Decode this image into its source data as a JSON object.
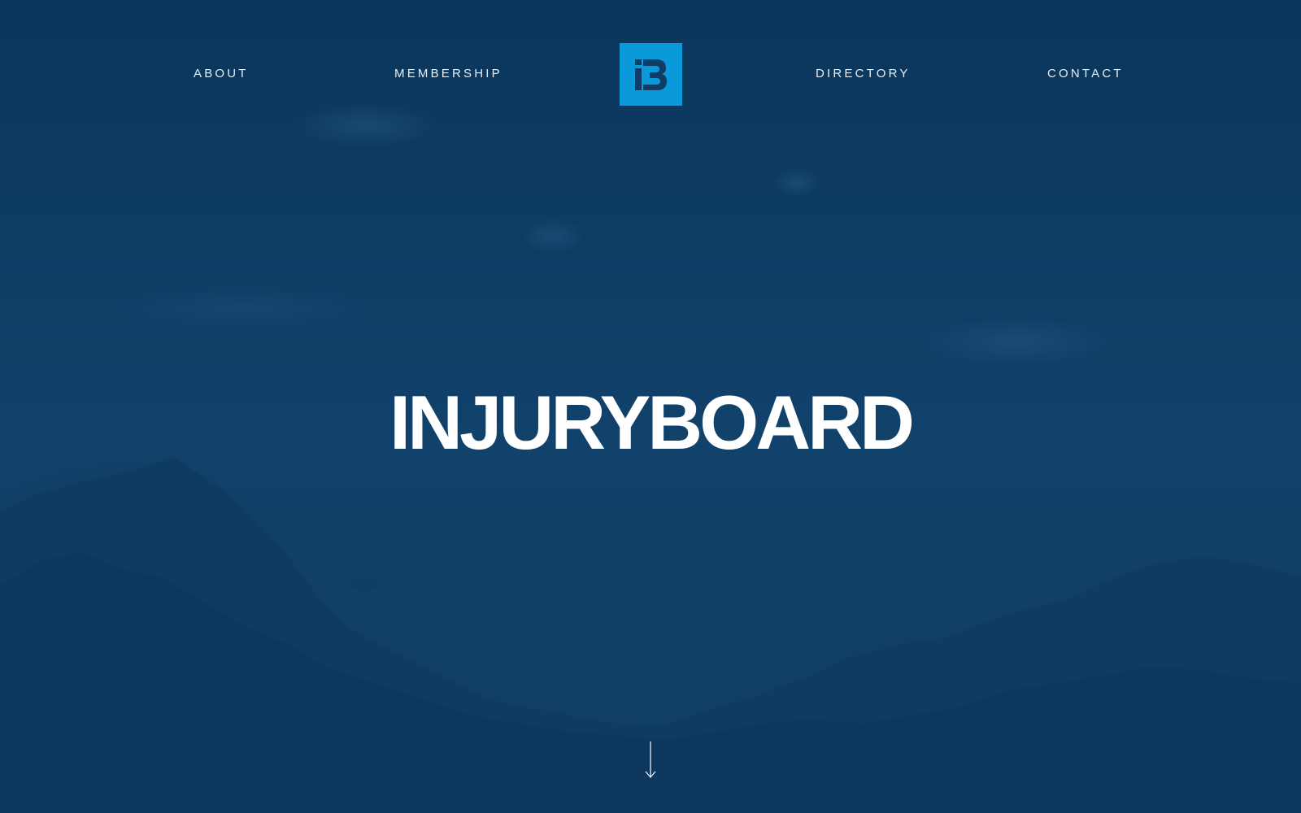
{
  "nav": {
    "about_label": "ABOUT",
    "membership_label": "MEMBERSHIP",
    "directory_label": "DIRECTORY",
    "contact_label": "CONTACT"
  },
  "logo": {
    "glyph": "IB",
    "background_color": "#0a9ad9",
    "glyph_color": "#0f3d66"
  },
  "hero": {
    "title": "INJURYBOARD",
    "background_image": "mountain-landscape",
    "overlay_color": "#0f3d66"
  },
  "scroll_indicator": {
    "icon": "arrow-down-icon"
  }
}
